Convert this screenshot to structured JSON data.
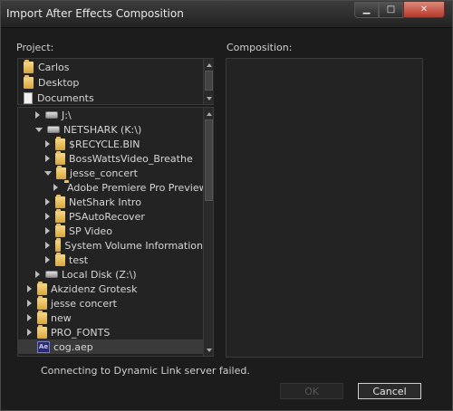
{
  "window": {
    "title": "Import After Effects Composition"
  },
  "project_label": "Project:",
  "composition_label": "Composition:",
  "favorites": [
    {
      "label": "Carlos",
      "icon": "folder-icon"
    },
    {
      "label": "Desktop",
      "icon": "folder-icon"
    },
    {
      "label": "Documents",
      "icon": "document-icon"
    }
  ],
  "tree": [
    {
      "label": "J:\\",
      "icon": "drive-icon",
      "expanded": false
    },
    {
      "label": "NETSHARK (K:\\)",
      "icon": "drive-icon",
      "expanded": true
    },
    {
      "label": "$RECYCLE.BIN",
      "icon": "folder-icon",
      "expanded": false
    },
    {
      "label": "BossWattsVideo_Breathe",
      "icon": "folder-icon",
      "expanded": false
    },
    {
      "label": "jesse_concert",
      "icon": "folder-icon",
      "expanded": true
    },
    {
      "label": "Adobe Premiere Pro Preview F",
      "icon": "folder-icon",
      "expanded": false
    },
    {
      "label": "NetShark Intro",
      "icon": "folder-icon",
      "expanded": false
    },
    {
      "label": "PSAutoRecover",
      "icon": "folder-icon",
      "expanded": false
    },
    {
      "label": "SP Video",
      "icon": "folder-icon",
      "expanded": false
    },
    {
      "label": "System Volume Information",
      "icon": "folder-icon",
      "expanded": false
    },
    {
      "label": "test",
      "icon": "folder-icon",
      "expanded": false
    },
    {
      "label": "Local Disk (Z:\\)",
      "icon": "drive-icon",
      "expanded": false
    },
    {
      "label": "Akzidenz Grotesk",
      "icon": "folder-icon",
      "expanded": false
    },
    {
      "label": "jesse concert",
      "icon": "folder-icon",
      "expanded": false
    },
    {
      "label": "new",
      "icon": "folder-icon",
      "expanded": false
    },
    {
      "label": "PRO_FONTS",
      "icon": "folder-icon",
      "expanded": false
    },
    {
      "label": "cog.aep",
      "icon": "after-effects-file-icon",
      "selected": true
    }
  ],
  "status_text": "Connecting to Dynamic Link server failed.",
  "ok_label": "OK",
  "cancel_label": "Cancel",
  "colors": {
    "background": "#1c1c1c",
    "panel": "#232323",
    "folder": "#e2b552",
    "close": "#c0392b"
  }
}
